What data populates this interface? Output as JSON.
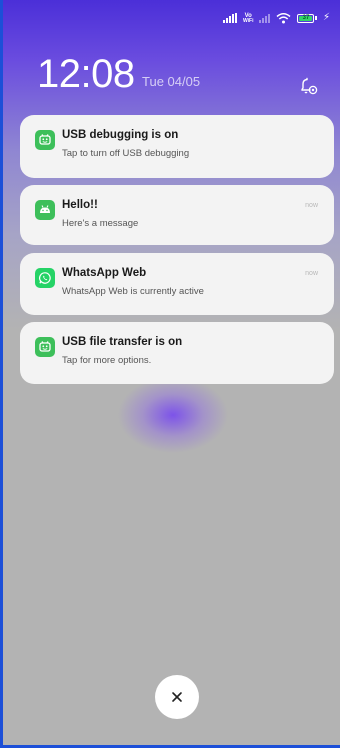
{
  "status_bar": {
    "volte_top": "Vo",
    "volte_bottom": "WiFi",
    "battery_level": "37",
    "icons": [
      "signal-icon",
      "wifi-calling-icon",
      "signal-dim-icon",
      "wifi-icon",
      "battery-icon",
      "charging-icon"
    ]
  },
  "lock": {
    "time": "12:08",
    "date": "Tue 04/05"
  },
  "notifications": [
    {
      "app_icon": "usb-debug-icon",
      "title": "USB debugging is on",
      "text": "Tap to turn off USB debugging",
      "time": "",
      "icon_color": "#3dbf5a"
    },
    {
      "app_icon": "android-icon",
      "title": "Hello!!",
      "text": "Here's a message",
      "time": "now",
      "icon_color": "#3dbf5a"
    },
    {
      "app_icon": "whatsapp-icon",
      "title": "WhatsApp Web",
      "text": "WhatsApp Web is currently active",
      "time": "now",
      "icon_color": "#25d366"
    },
    {
      "app_icon": "usb-debug-icon",
      "title": "USB file transfer is on",
      "text": "Tap for more options.",
      "time": "",
      "icon_color": "#3dbf5a"
    }
  ],
  "colors": {
    "accent_purple": "#5a3be0",
    "card_bg": "#f3f3f3",
    "background_gray": "#b3b3b3",
    "border_blue": "#1c4fd8"
  }
}
